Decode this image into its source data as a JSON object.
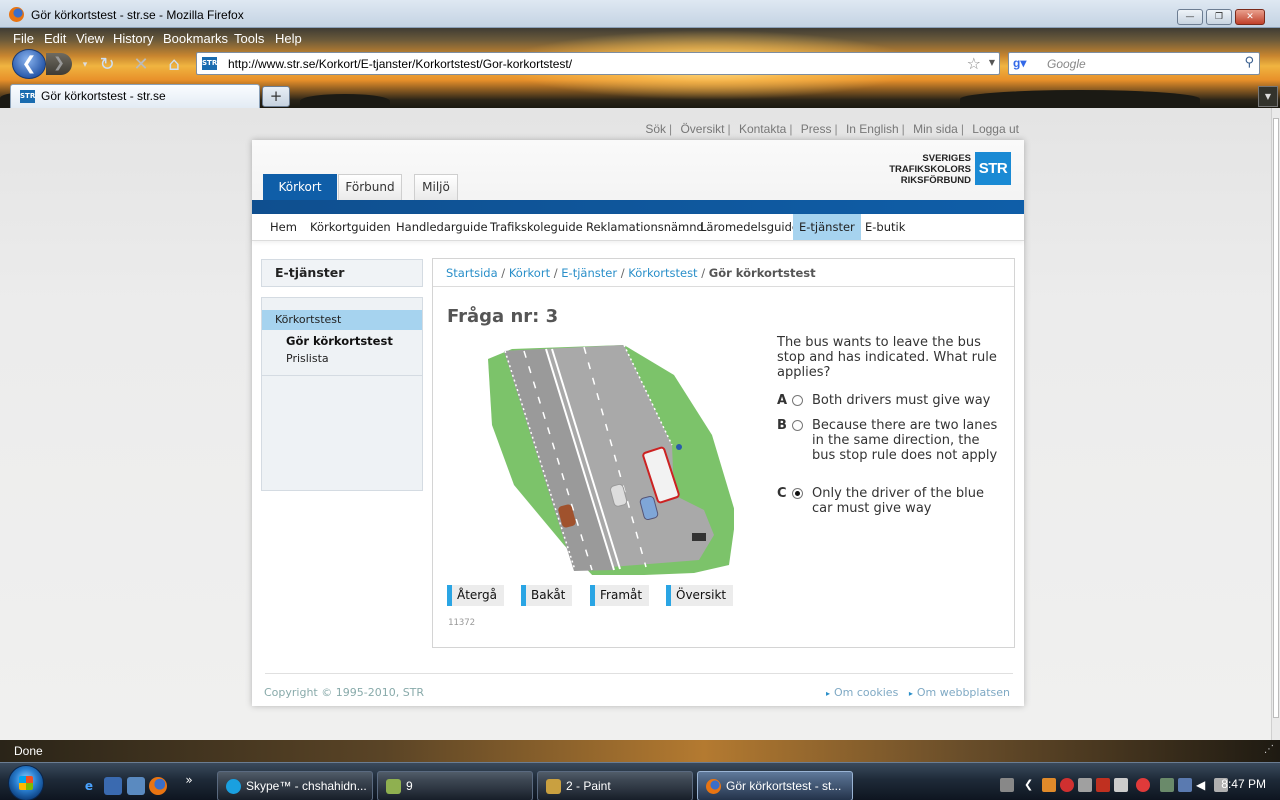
{
  "window": {
    "title": "Gör körkortstest - str.se - Mozilla Firefox"
  },
  "menu": [
    "File",
    "Edit",
    "View",
    "History",
    "Bookmarks",
    "Tools",
    "Help"
  ],
  "nav": {
    "url": "http://www.str.se/Korkort/E-tjanster/Korkortstest/Gor-korkortstest/",
    "search_placeholder": "Google",
    "site_icon": "STR"
  },
  "tab": {
    "label": "Gör körkortstest - str.se",
    "new_tab": "+"
  },
  "top_links": [
    "Sök",
    "Översikt",
    "Kontakta",
    "Press",
    "In English",
    "Min sida",
    "Logga ut"
  ],
  "site": {
    "main_tabs": [
      "Körkort",
      "Förbund",
      "Miljö"
    ],
    "logo": {
      "line1": "SVERIGES",
      "line2": "TRAFIKSKOLORS",
      "line3": "RIKSFÖRBUND",
      "badge": "STR"
    },
    "subnav": [
      "Hem",
      "Körkortguiden",
      "Handledarguide",
      "Trafikskoleguide",
      "Reklamationsnämnd",
      "Läromedelsguide",
      "E-tjänster",
      "E-butik"
    ]
  },
  "sidebar": {
    "heading": "E-tjänster",
    "selected": "Körkortstest",
    "sub_current": "Gör körkortstest",
    "sub_other": "Prislista"
  },
  "breadcrumb": {
    "items": [
      "Startsida",
      "Körkort",
      "E-tjänster",
      "Körkortstest"
    ],
    "current": "Gör körkortstest"
  },
  "question": {
    "title": "Fråga nr: 3",
    "text": "The bus wants to leave the bus stop and has indicated. What rule applies?",
    "options": [
      {
        "letter": "A",
        "text": "Both drivers must give way",
        "selected": false
      },
      {
        "letter": "B",
        "text": "Because there are two lanes in the same direction, the bus stop rule does not apply",
        "selected": false
      },
      {
        "letter": "C",
        "text": "Only the driver of the blue car must give way",
        "selected": true
      }
    ],
    "buttons": [
      "Återgå",
      "Bakåt",
      "Framåt",
      "Översikt"
    ],
    "id": "11372"
  },
  "footer": {
    "copyright": "Copyright © 1995-2010, STR",
    "links": [
      "Om cookies",
      "Om webbplatsen"
    ]
  },
  "status": {
    "text": "Done"
  },
  "taskbar": {
    "tasks": [
      "Skype™ - chshahidn...",
      "9",
      "2 - Paint",
      "Gör körkortstest - st..."
    ],
    "overflow": "»",
    "clock": "8:47 PM"
  },
  "colors": {
    "brand_blue": "#0f5ea8",
    "highlight_blue": "#a6d3ef",
    "link_blue": "#2a8fc9",
    "button_accent": "#2aa5e4"
  }
}
